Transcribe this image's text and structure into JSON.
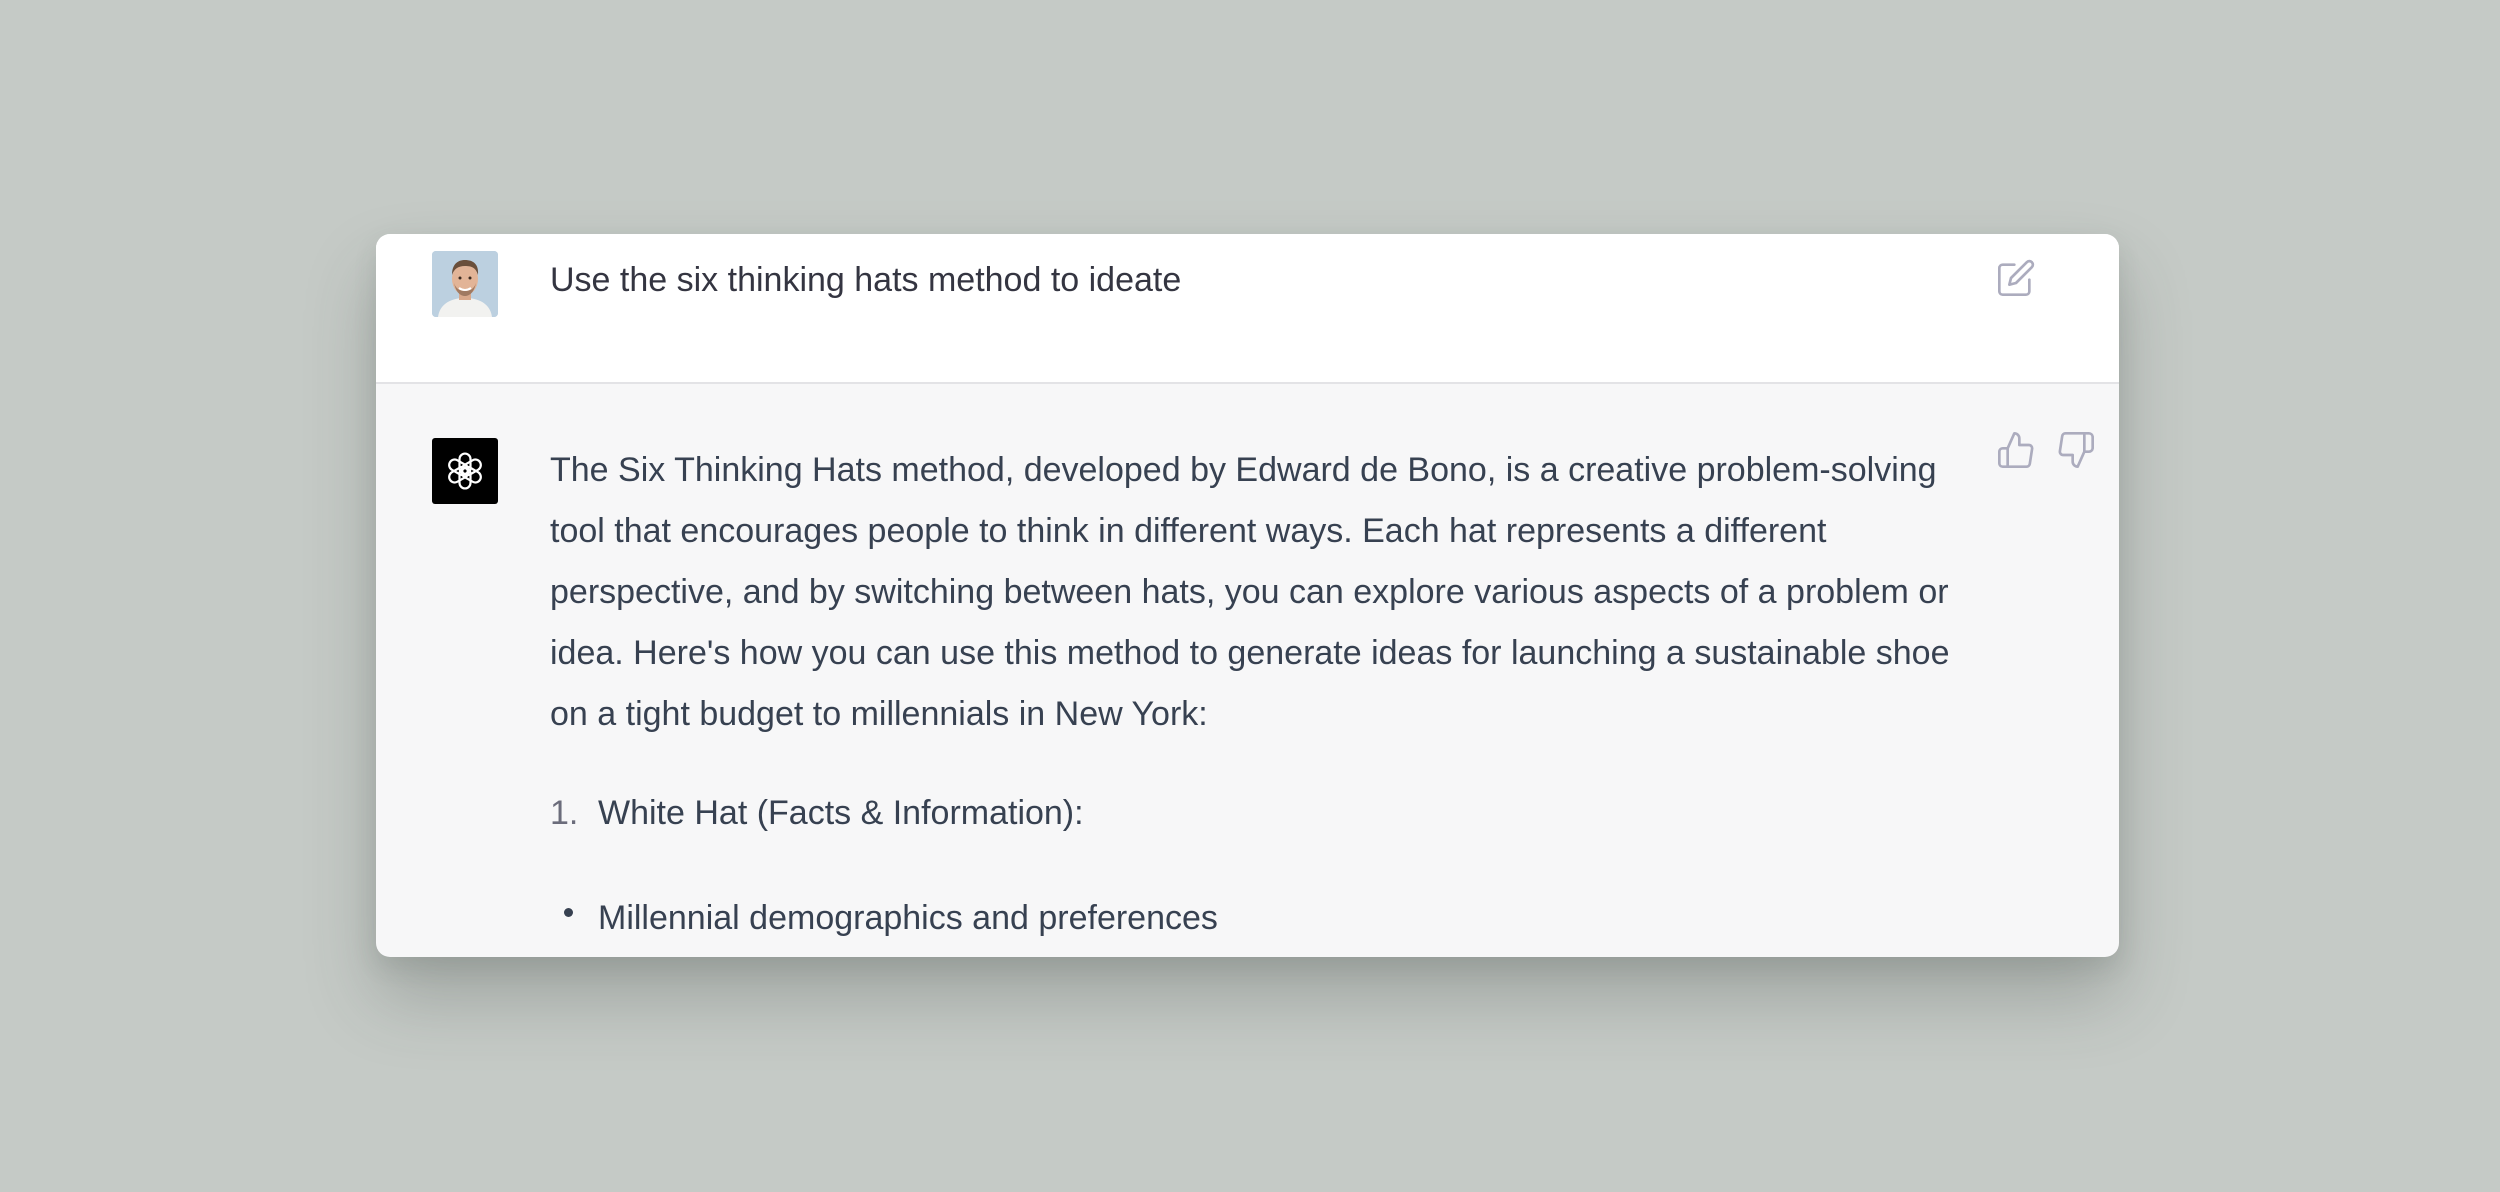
{
  "user_message": {
    "text": "Use the six thinking hats method to ideate"
  },
  "assistant_message": {
    "paragraph": "The Six Thinking Hats method, developed by Edward de Bono, is a creative problem-solving tool that encourages people to think in different ways. Each hat represents a different perspective, and by switching between hats, you can explore various aspects of a problem or idea. Here's how you can use this method to generate ideas for launching a sustainable shoe on a tight budget to millennials in New York:",
    "ordered_list": [
      {
        "number": "1.",
        "label": "White Hat (Facts & Information):"
      }
    ],
    "bullets": [
      {
        "label": "Millennial demographics and preferences"
      }
    ]
  },
  "icons": {
    "edit": "edit-icon",
    "thumbs_up": "thumbs-up-icon",
    "thumbs_down": "thumbs-down-icon",
    "assistant_logo": "openai-logo-icon"
  },
  "colors": {
    "page_background": "#c5cac6",
    "user_row_background": "#ffffff",
    "assistant_row_background": "#f7f7f8",
    "text": "#374151",
    "icon": "#acacbe",
    "bot_avatar_background": "#000000"
  }
}
